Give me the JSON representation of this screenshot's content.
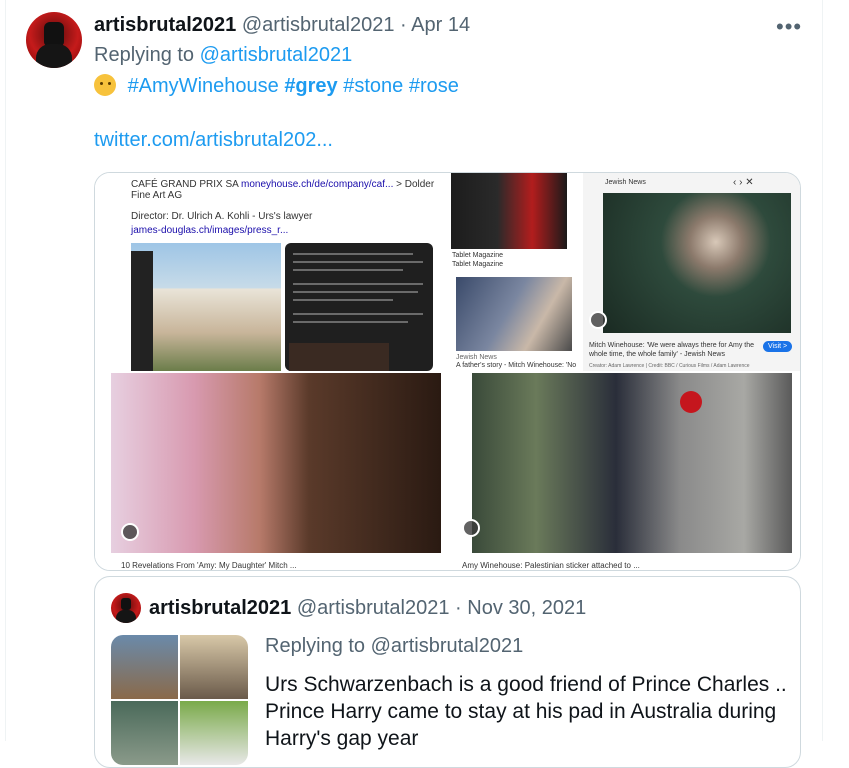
{
  "tweet": {
    "display_name": "artisbrutal2021",
    "handle": "@artisbrutal2021",
    "separator": "·",
    "date": "Apr 14",
    "more_icon": "more-horizontal-icon",
    "replying_prefix": "Replying to ",
    "replying_to": "@artisbrutal2021",
    "emoji": "thinking-face-emoji",
    "hashtags": [
      "#AmyWinehouse",
      "#grey",
      "#stone",
      "#rose"
    ],
    "link": "twitter.com/artisbrutal202..."
  },
  "media": {
    "doc": {
      "line1_prefix": "CAFÉ GRAND PRIX SA ",
      "line1_link": "moneyhouse.ch/de/company/caf...",
      "line1_suffix": " > Dolder Fine Art AG",
      "line2": "Director: Dr. Ulrich A. Kohli - Urs's lawyer",
      "line3": "james-douglas.ch/images/press_r..."
    },
    "tablet_label": "Tablet Magazine",
    "tablet_sub": "Tablet Magazine",
    "jewish_news_source": "Jewish News",
    "jewish_news_source2": "Jewish News",
    "jewish_news_caption": "A father's story - Mitch Winehouse: 'No ...",
    "jewish_news_card_title": "Mitch Winehouse: 'We were always there for Amy the whole time, the whole family' - Jewish News",
    "jewish_news_credit": "Creator: Adam Lawrence | Credit: BBC / Curious Films / Adam Lawrence",
    "visit_label": "Visit >",
    "bottom_left_caption": "10 Revelations From 'Amy: My Daughter' Mitch ...",
    "bottom_right_caption": "Amy Winehouse: Palestinian sticker attached to ..."
  },
  "quote": {
    "display_name": "artisbrutal2021",
    "handle": "@artisbrutal2021",
    "separator": "·",
    "date": "Nov 30, 2021",
    "replying_prefix": "Replying to ",
    "replying_to": "@artisbrutal2021",
    "text": "Urs Schwarzenbach is a good friend of Prince Charles .. Prince Harry came to stay at his pad in Australia during Harry's gap year"
  }
}
